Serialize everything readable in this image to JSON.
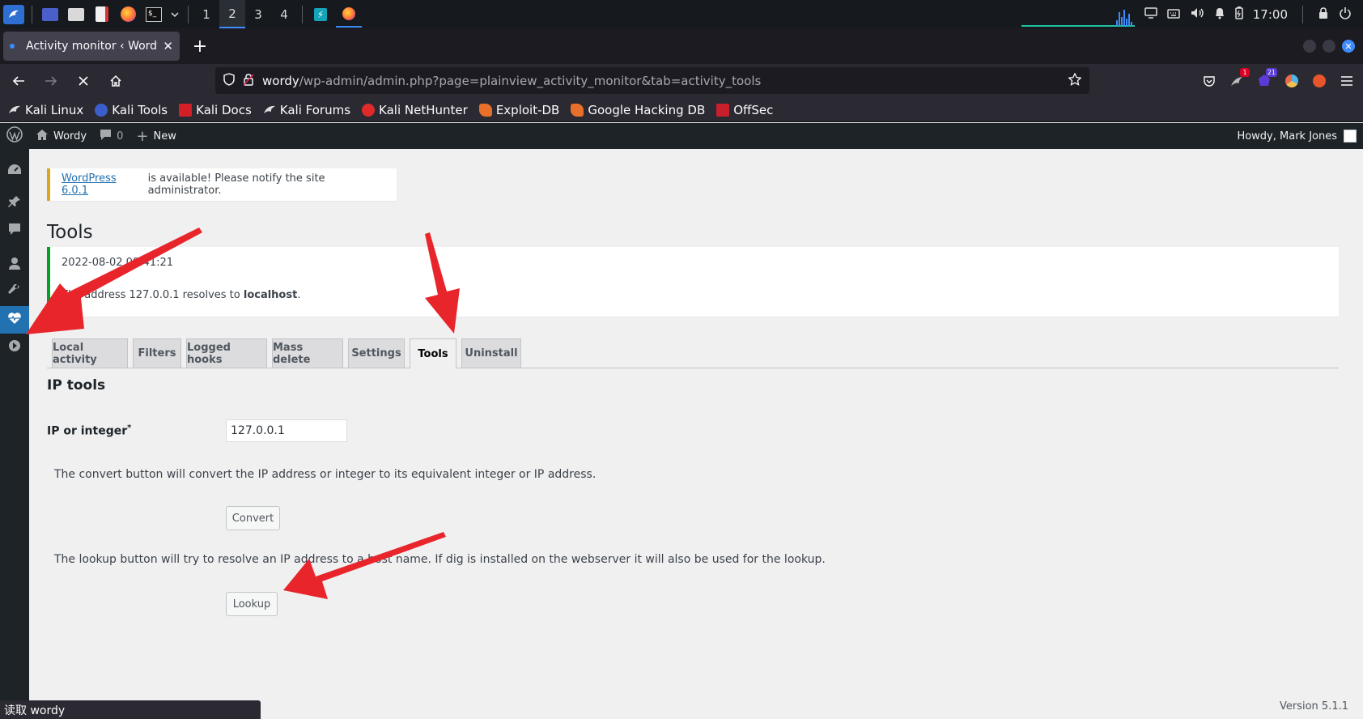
{
  "taskbar": {
    "workspaces": [
      "1",
      "2",
      "3",
      "4"
    ],
    "active_workspace": "2",
    "clock": "17:00"
  },
  "browser": {
    "tab_title": "Activity monitor ‹ Wordy ·",
    "url_host": "wordy",
    "url_path": "/wp-admin/admin.php?page=plainview_activity_monitor&tab=activity_tools",
    "ext_badge_1": "1",
    "ext_badge_2": "21",
    "bookmarks": [
      {
        "label": "Kali Linux",
        "icon": "kali-dragon-icon"
      },
      {
        "label": "Kali Tools",
        "icon": "kali-tools-icon"
      },
      {
        "label": "Kali Docs",
        "icon": "kali-docs-icon"
      },
      {
        "label": "Kali Forums",
        "icon": "kali-forums-icon"
      },
      {
        "label": "Kali NetHunter",
        "icon": "nethunter-icon"
      },
      {
        "label": "Exploit-DB",
        "icon": "exploit-db-icon"
      },
      {
        "label": "Google Hacking DB",
        "icon": "ghdb-icon"
      },
      {
        "label": "OffSec",
        "icon": "offsec-icon"
      }
    ],
    "status_text": "读取 wordy"
  },
  "adminbar": {
    "site_name": "Wordy",
    "comments_count": "0",
    "new_label": "New",
    "howdy": "Howdy, Mark Jones"
  },
  "notice": {
    "link": "WordPress 6.0.1",
    "text": "is available! Please notify the site administrator."
  },
  "page_title": "Tools",
  "result": {
    "timestamp": "2022-08-02 09:41:21",
    "message_prefix": "The address 127.0.0.1 resolves to",
    "message_host": "localhost",
    "message_suffix": "."
  },
  "tabs": [
    "Local activity",
    "Filters",
    "Logged hooks",
    "Mass delete",
    "Settings",
    "Tools",
    "Uninstall"
  ],
  "active_tab": "Tools",
  "ip_tools": {
    "section_title": "IP tools",
    "field_label": "IP or integer",
    "required_mark": "*",
    "ip_value": "127.0.0.1",
    "convert_desc": "The convert button will convert the IP address or integer to its equivalent integer or IP address.",
    "convert_label": "Convert",
    "lookup_desc": "The lookup button will try to resolve an IP address to a host name. If dig is installed on the webserver it will also be used for the lookup.",
    "lookup_label": "Lookup"
  },
  "footer": {
    "version": "Version 5.1.1"
  },
  "colors": {
    "wp_admin_dark": "#1d2327",
    "wp_blue": "#2271b1",
    "notice_warning": "#dba617",
    "notice_success": "#00a32a",
    "arrow_red": "#e8252b"
  }
}
